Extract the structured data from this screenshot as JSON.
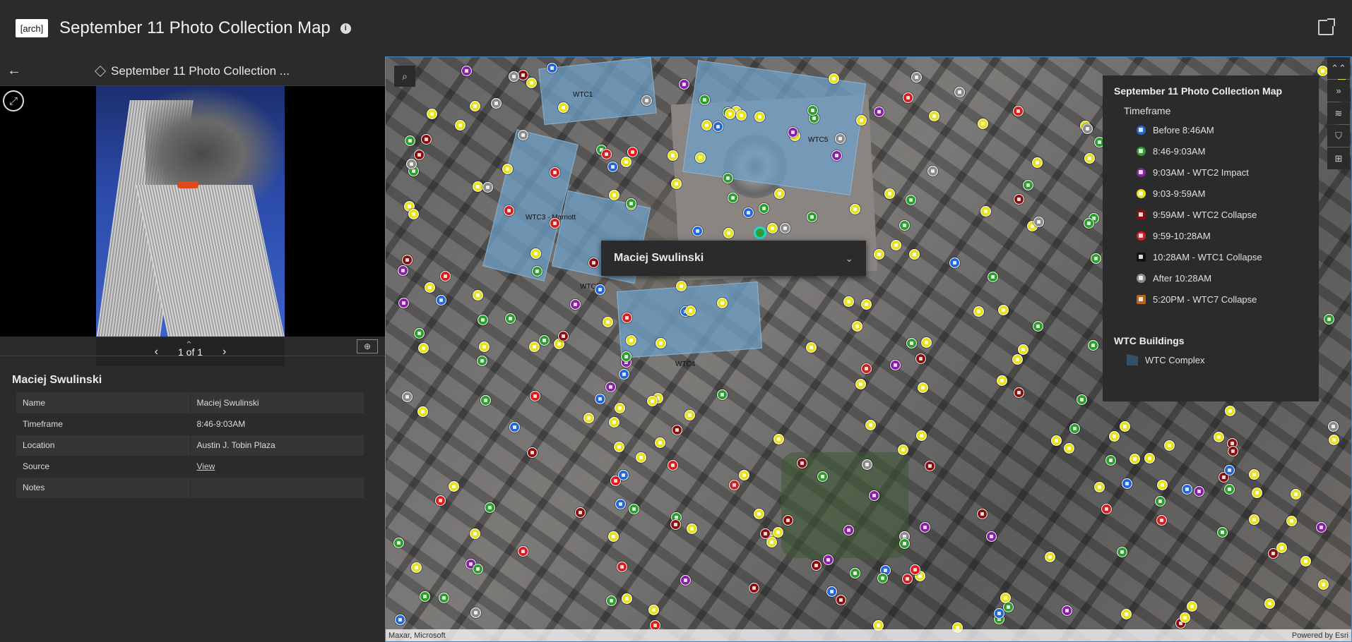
{
  "header": {
    "logo_label": "[arch]",
    "title": "September 11 Photo Collection Map",
    "info_icon": "i"
  },
  "panel": {
    "back_icon": "←",
    "title": "September 11 Photo Collection ...",
    "expand_icon": "⤢",
    "pager": {
      "text": "1 of 1",
      "prev": "‹",
      "next": "›"
    },
    "collapse_icon": "⌃",
    "zoom_icon": "⊕",
    "feature_title": "Maciej Swulinski",
    "attributes": [
      {
        "label": "Name",
        "value": "Maciej Swulinski"
      },
      {
        "label": "Timeframe",
        "value": "8:46-9:03AM"
      },
      {
        "label": "Location",
        "value": "Austin J. Tobin Plaza"
      },
      {
        "label": "Source",
        "value": "View"
      },
      {
        "label": "Notes",
        "value": ""
      }
    ]
  },
  "map": {
    "search_icon": "⌕",
    "building_labels": [
      "WTC1",
      "WTC5",
      "WTC3 - Marriott",
      "WTC2",
      "WTC4"
    ],
    "popup": {
      "title": "Maciej Swulinski",
      "chevron": "⌄"
    },
    "tools": [
      "⌃⌃",
      "»",
      "≋",
      "⛉",
      "⊞"
    ],
    "attribution_left": "Maxar, Microsoft",
    "attribution_right": "Powered by Esri"
  },
  "legend": {
    "title": "September 11 Photo Collection Map",
    "timeframe_label": "Timeframe",
    "items": [
      {
        "label": "Before 8:46AM",
        "color": "#2368d6"
      },
      {
        "label": "8:46-9:03AM",
        "color": "#2f9e2f"
      },
      {
        "label": "9:03AM - WTC2 Impact",
        "color": "#8a1fa8"
      },
      {
        "label": "9:03-9:59AM",
        "color": "#e8e21b"
      },
      {
        "label": "9:59AM - WTC2 Collapse",
        "color": "#8a1010"
      },
      {
        "label": "9:59-10:28AM",
        "color": "#d81e1e"
      },
      {
        "label": "10:28AM - WTC1 Collapse",
        "color": "#111111"
      },
      {
        "label": "After 10:28AM",
        "color": "#8c8c8c"
      },
      {
        "label": "5:20PM - WTC7 Collapse",
        "color": "#b8641a"
      }
    ],
    "buildings_title": "WTC Buildings",
    "buildings_item": "WTC Complex"
  }
}
